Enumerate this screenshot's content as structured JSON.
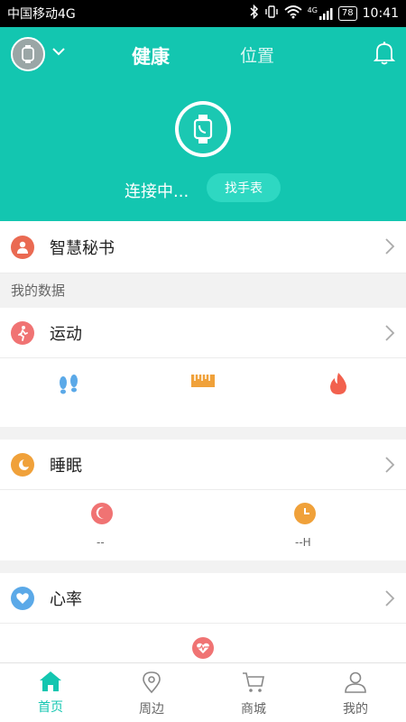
{
  "status_bar": {
    "carrier": "中国移动4G",
    "network": "4G",
    "battery": "78",
    "time": "10:41"
  },
  "header": {
    "tabs": {
      "health": "健康",
      "location": "位置"
    },
    "connection_status": "连接中...",
    "find_watch_button": "找手表"
  },
  "rows": {
    "assistant": "智慧秘书",
    "section_my_data": "我的数据",
    "sport": "运动",
    "sleep": "睡眠",
    "heart": "心率"
  },
  "sleep_values": {
    "sleep_value": "--",
    "wake_value": "--H"
  },
  "bottom_nav": {
    "home": "首页",
    "nearby": "周边",
    "mall": "商城",
    "mine": "我的"
  },
  "colors": {
    "accent": "#13c6b0",
    "assistant_icon": "#ea6a52",
    "sport_icon": "#f07373",
    "sleep_icon": "#f0a13a",
    "heart_icon": "#5ba9e8"
  }
}
